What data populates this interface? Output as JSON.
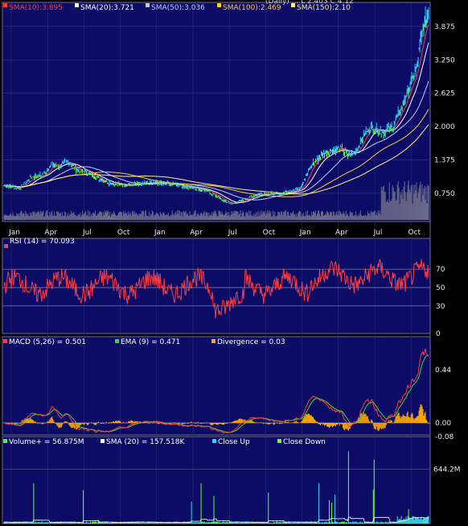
{
  "chart_data": [
    {
      "type": "line",
      "panel": "price",
      "header_partial": "(Daily)  ...  L 2.403  C 4.12",
      "legend": [
        {
          "name": "SMA(10):3.895",
          "color": "#ff3b3b"
        },
        {
          "name": "SMA(20):3.721",
          "color": "#ffffff"
        },
        {
          "name": "SMA(50):3.036",
          "color": "#c8c8ff"
        },
        {
          "name": "SMA(100):2.469",
          "color": "#ffcc33"
        },
        {
          "name": "SMA(150):2.10",
          "color": "#ffee88"
        }
      ],
      "y_ticks": [
        "3.875",
        "3.250",
        "2.625",
        "2.000",
        "1.375",
        "0.750"
      ],
      "y_tick_values": [
        3.875,
        3.25,
        2.625,
        2.0,
        1.375,
        0.75
      ],
      "x_ticks": [
        "Jan",
        "Apr",
        "Jul",
        "Oct",
        "Jan",
        "Apr",
        "Jul",
        "Oct",
        "Jan",
        "Apr",
        "Jul",
        "Oct"
      ],
      "ylim": [
        0.25,
        4.25
      ],
      "price_keypoints": [
        {
          "t": 0,
          "v": 0.9
        },
        {
          "t": 20,
          "v": 0.85
        },
        {
          "t": 35,
          "v": 1.05
        },
        {
          "t": 50,
          "v": 1.1
        },
        {
          "t": 60,
          "v": 1.3
        },
        {
          "t": 70,
          "v": 1.25
        },
        {
          "t": 80,
          "v": 1.35
        },
        {
          "t": 90,
          "v": 1.2
        },
        {
          "t": 100,
          "v": 1.15
        },
        {
          "t": 115,
          "v": 1.05
        },
        {
          "t": 130,
          "v": 0.95
        },
        {
          "t": 150,
          "v": 0.9
        },
        {
          "t": 170,
          "v": 0.92
        },
        {
          "t": 190,
          "v": 0.95
        },
        {
          "t": 210,
          "v": 0.92
        },
        {
          "t": 225,
          "v": 0.88
        },
        {
          "t": 240,
          "v": 0.85
        },
        {
          "t": 255,
          "v": 0.78
        },
        {
          "t": 265,
          "v": 0.7
        },
        {
          "t": 275,
          "v": 0.6
        },
        {
          "t": 285,
          "v": 0.55
        },
        {
          "t": 295,
          "v": 0.6
        },
        {
          "t": 310,
          "v": 0.7
        },
        {
          "t": 325,
          "v": 0.75
        },
        {
          "t": 340,
          "v": 0.73
        },
        {
          "t": 355,
          "v": 0.78
        },
        {
          "t": 370,
          "v": 0.85
        },
        {
          "t": 385,
          "v": 1.3
        },
        {
          "t": 400,
          "v": 1.5
        },
        {
          "t": 410,
          "v": 1.55
        },
        {
          "t": 420,
          "v": 1.6
        },
        {
          "t": 430,
          "v": 1.45
        },
        {
          "t": 440,
          "v": 1.55
        },
        {
          "t": 450,
          "v": 1.85
        },
        {
          "t": 458,
          "v": 2.0
        },
        {
          "t": 465,
          "v": 1.95
        },
        {
          "t": 475,
          "v": 1.9
        },
        {
          "t": 485,
          "v": 2.0
        },
        {
          "t": 495,
          "v": 2.3
        },
        {
          "t": 505,
          "v": 2.7
        },
        {
          "t": 515,
          "v": 3.1
        },
        {
          "t": 520,
          "v": 3.6
        },
        {
          "t": 525,
          "v": 3.9
        },
        {
          "t": 530,
          "v": 4.12
        }
      ]
    },
    {
      "type": "line",
      "panel": "rsi",
      "legend": [
        {
          "name": "RSI (14) = 70.093",
          "color": "#ff3b3b"
        }
      ],
      "y_ticks": [
        "70",
        "50",
        "30",
        "0"
      ],
      "y_tick_values": [
        70,
        50,
        30,
        0
      ],
      "ylim": [
        0,
        100
      ]
    },
    {
      "type": "line",
      "panel": "macd",
      "legend": [
        {
          "name": "MACD (5,26) = 0.501",
          "color": "#ff3b3b"
        },
        {
          "name": "EMA (9) = 0.471",
          "color": "#33dd33"
        },
        {
          "name": "Divergence = 0.03",
          "color": "#ffaa00"
        }
      ],
      "y_ticks": [
        "0.44",
        "0.00",
        "-0.08"
      ],
      "y_tick_values": [
        0.44,
        0.0,
        -0.08
      ],
      "ylim": [
        -0.1,
        0.62
      ]
    },
    {
      "type": "bar",
      "panel": "volume",
      "legend": [
        {
          "name": "Volume+ = 56.875M",
          "color": "#55ee55"
        },
        {
          "name": "SMA (20) = 157.518K",
          "color": "#ffffff"
        },
        {
          "name": "Close Up",
          "color": "#33ccff"
        },
        {
          "name": "Close Down",
          "color": "#66ff33"
        }
      ],
      "y_ticks": [
        "644.2M"
      ],
      "y_tick_values": [
        644.2
      ],
      "ylim": [
        0,
        900
      ]
    }
  ]
}
